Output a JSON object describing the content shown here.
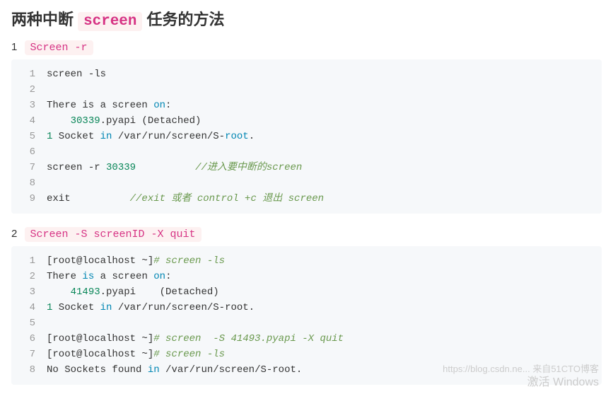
{
  "heading": {
    "part1": "两种中断",
    "code": "screen",
    "part2": "任务的方法"
  },
  "step1": {
    "num": "1",
    "code": "Screen -r"
  },
  "step2": {
    "num": "2",
    "code": "Screen -S screenID -X quit"
  },
  "code1": {
    "l1": {
      "a": "screen ",
      "b": "-ls"
    },
    "l3": {
      "a": "There is a screen ",
      "b": "on",
      "c": ":"
    },
    "l4": {
      "a": "    ",
      "b": "30339",
      "c": ".pyapi (Detached)"
    },
    "l5": {
      "a": "1",
      "b": " Socket ",
      "c": "in",
      "d": " /var/run/screen/S-",
      "e": "root",
      "f": "."
    },
    "l7": {
      "a": "screen ",
      "b": "-r ",
      "c": "30339",
      "pad": "          ",
      "d": "//进入要中断的screen"
    },
    "l9": {
      "a": "exit",
      "pad": "          ",
      "b": "//exit 或者 control +c 退出 screen"
    }
  },
  "code2": {
    "l1": {
      "a": "[root@localhost ~]",
      "b": "# screen -ls"
    },
    "l2": {
      "a": "There ",
      "b": "is",
      "c": " a screen ",
      "d": "on",
      "e": ":"
    },
    "l3": {
      "a": "    ",
      "b": "41493",
      "c": ".pyapi    (Detached)"
    },
    "l4": {
      "a": "1",
      "b": " Socket ",
      "c": "in",
      "d": " /var/run/screen/S-root."
    },
    "l6": {
      "a": "[root@localhost ~]",
      "b": "# screen  -S 41493.pyapi -X quit"
    },
    "l7": {
      "a": "[root@localhost ~]",
      "b": "# screen -ls"
    },
    "l8": {
      "a": "No Sockets found ",
      "b": "in",
      "c": " /var/run/screen/S-root."
    }
  },
  "watermark": {
    "line1": "https://blog.csdn.ne... 来自51CTO博客",
    "line2": "激活 Windows"
  }
}
